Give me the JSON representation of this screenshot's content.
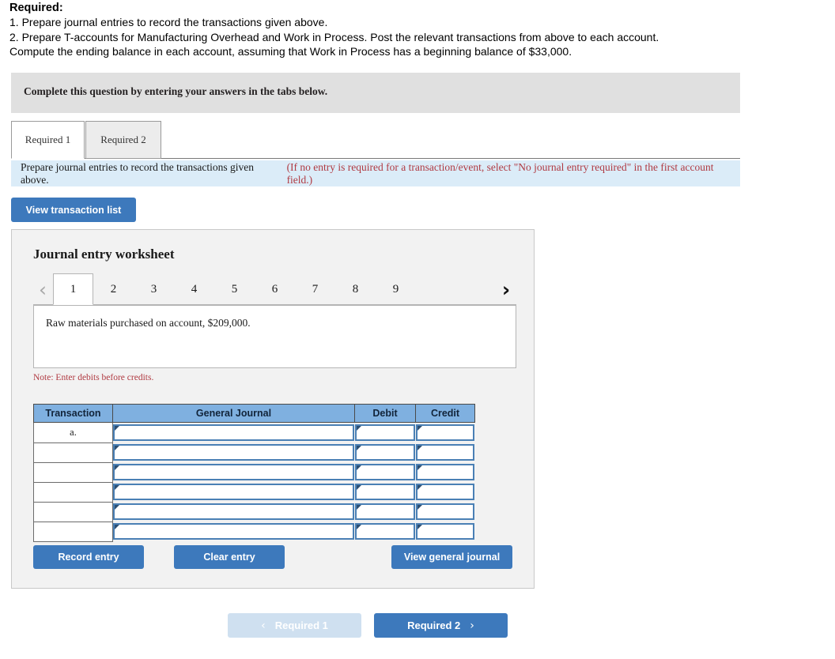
{
  "required": {
    "title": "Required:",
    "line1": "1. Prepare journal entries to record the transactions given above.",
    "line2": "2. Prepare T-accounts for Manufacturing Overhead and Work in Process. Post the relevant transactions from above to each account.",
    "line3": "Compute the ending balance in each account, assuming that Work in Process has a beginning balance of $33,000."
  },
  "gray_banner": {
    "text": "Complete this question by entering your answers in the tabs below."
  },
  "tabs": [
    {
      "label": "Required 1",
      "active": true
    },
    {
      "label": "Required 2",
      "active": false
    }
  ],
  "blue_banner": {
    "main": "Prepare journal entries to record the transactions given above.",
    "note": "(If no entry is required for a transaction/event, select \"No journal entry required\" in the first account field.)"
  },
  "toolbar": {
    "view_transaction_list": "View transaction list"
  },
  "worksheet": {
    "title": "Journal entry worksheet",
    "pager": {
      "prev_icon": "chevron-left",
      "next_icon": "chevron-right",
      "prev_glyph": "‹",
      "next_glyph": "›",
      "pages": [
        "1",
        "2",
        "3",
        "4",
        "5",
        "6",
        "7",
        "8",
        "9"
      ],
      "active_page": "1"
    },
    "description": "Raw materials purchased on account, $209,000.",
    "note": "Note: Enter debits before credits.",
    "table": {
      "headers": [
        "Transaction",
        "General Journal",
        "Debit",
        "Credit"
      ],
      "rows": [
        {
          "transaction": "a.",
          "general_journal": "",
          "debit": "",
          "credit": ""
        },
        {
          "transaction": "",
          "general_journal": "",
          "debit": "",
          "credit": ""
        },
        {
          "transaction": "",
          "general_journal": "",
          "debit": "",
          "credit": ""
        },
        {
          "transaction": "",
          "general_journal": "",
          "debit": "",
          "credit": ""
        },
        {
          "transaction": "",
          "general_journal": "",
          "debit": "",
          "credit": ""
        },
        {
          "transaction": "",
          "general_journal": "",
          "debit": "",
          "credit": ""
        }
      ]
    },
    "actions": {
      "record_entry": "Record entry",
      "clear_entry": "Clear entry",
      "view_general_journal": "View general journal"
    }
  },
  "footer_nav": {
    "prev_label": "Required 1",
    "next_label": "Required 2",
    "prev_glyph": "‹",
    "next_glyph": "›",
    "prev_disabled": true
  },
  "colors": {
    "primary_blue": "#3d79bc",
    "disabled_blue": "#cfe0f0",
    "table_header_blue": "#7fb0e0",
    "banner_blue": "#dbecf8",
    "banner_gray": "#e0e0e0",
    "panel_gray": "#f2f2f2",
    "note_red": "#b03a42",
    "input_border_blue": "#4a80b5"
  }
}
